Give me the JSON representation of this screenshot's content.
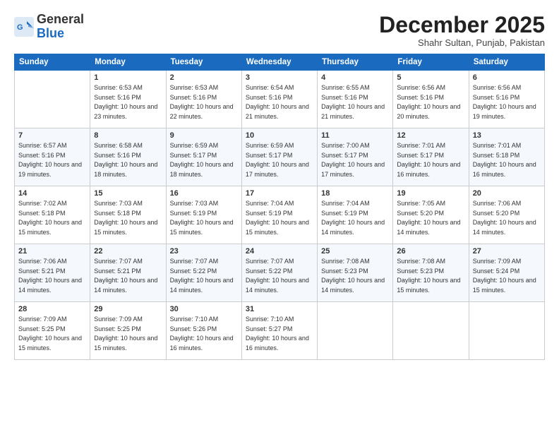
{
  "header": {
    "logo_line1": "General",
    "logo_line2": "Blue",
    "month": "December 2025",
    "location": "Shahr Sultan, Punjab, Pakistan"
  },
  "weekdays": [
    "Sunday",
    "Monday",
    "Tuesday",
    "Wednesday",
    "Thursday",
    "Friday",
    "Saturday"
  ],
  "weeks": [
    [
      {
        "day": "",
        "sunrise": "",
        "sunset": "",
        "daylight": ""
      },
      {
        "day": "1",
        "sunrise": "Sunrise: 6:53 AM",
        "sunset": "Sunset: 5:16 PM",
        "daylight": "Daylight: 10 hours and 23 minutes."
      },
      {
        "day": "2",
        "sunrise": "Sunrise: 6:53 AM",
        "sunset": "Sunset: 5:16 PM",
        "daylight": "Daylight: 10 hours and 22 minutes."
      },
      {
        "day": "3",
        "sunrise": "Sunrise: 6:54 AM",
        "sunset": "Sunset: 5:16 PM",
        "daylight": "Daylight: 10 hours and 21 minutes."
      },
      {
        "day": "4",
        "sunrise": "Sunrise: 6:55 AM",
        "sunset": "Sunset: 5:16 PM",
        "daylight": "Daylight: 10 hours and 21 minutes."
      },
      {
        "day": "5",
        "sunrise": "Sunrise: 6:56 AM",
        "sunset": "Sunset: 5:16 PM",
        "daylight": "Daylight: 10 hours and 20 minutes."
      },
      {
        "day": "6",
        "sunrise": "Sunrise: 6:56 AM",
        "sunset": "Sunset: 5:16 PM",
        "daylight": "Daylight: 10 hours and 19 minutes."
      }
    ],
    [
      {
        "day": "7",
        "sunrise": "Sunrise: 6:57 AM",
        "sunset": "Sunset: 5:16 PM",
        "daylight": "Daylight: 10 hours and 19 minutes."
      },
      {
        "day": "8",
        "sunrise": "Sunrise: 6:58 AM",
        "sunset": "Sunset: 5:16 PM",
        "daylight": "Daylight: 10 hours and 18 minutes."
      },
      {
        "day": "9",
        "sunrise": "Sunrise: 6:59 AM",
        "sunset": "Sunset: 5:17 PM",
        "daylight": "Daylight: 10 hours and 18 minutes."
      },
      {
        "day": "10",
        "sunrise": "Sunrise: 6:59 AM",
        "sunset": "Sunset: 5:17 PM",
        "daylight": "Daylight: 10 hours and 17 minutes."
      },
      {
        "day": "11",
        "sunrise": "Sunrise: 7:00 AM",
        "sunset": "Sunset: 5:17 PM",
        "daylight": "Daylight: 10 hours and 17 minutes."
      },
      {
        "day": "12",
        "sunrise": "Sunrise: 7:01 AM",
        "sunset": "Sunset: 5:17 PM",
        "daylight": "Daylight: 10 hours and 16 minutes."
      },
      {
        "day": "13",
        "sunrise": "Sunrise: 7:01 AM",
        "sunset": "Sunset: 5:18 PM",
        "daylight": "Daylight: 10 hours and 16 minutes."
      }
    ],
    [
      {
        "day": "14",
        "sunrise": "Sunrise: 7:02 AM",
        "sunset": "Sunset: 5:18 PM",
        "daylight": "Daylight: 10 hours and 15 minutes."
      },
      {
        "day": "15",
        "sunrise": "Sunrise: 7:03 AM",
        "sunset": "Sunset: 5:18 PM",
        "daylight": "Daylight: 10 hours and 15 minutes."
      },
      {
        "day": "16",
        "sunrise": "Sunrise: 7:03 AM",
        "sunset": "Sunset: 5:19 PM",
        "daylight": "Daylight: 10 hours and 15 minutes."
      },
      {
        "day": "17",
        "sunrise": "Sunrise: 7:04 AM",
        "sunset": "Sunset: 5:19 PM",
        "daylight": "Daylight: 10 hours and 15 minutes."
      },
      {
        "day": "18",
        "sunrise": "Sunrise: 7:04 AM",
        "sunset": "Sunset: 5:19 PM",
        "daylight": "Daylight: 10 hours and 14 minutes."
      },
      {
        "day": "19",
        "sunrise": "Sunrise: 7:05 AM",
        "sunset": "Sunset: 5:20 PM",
        "daylight": "Daylight: 10 hours and 14 minutes."
      },
      {
        "day": "20",
        "sunrise": "Sunrise: 7:06 AM",
        "sunset": "Sunset: 5:20 PM",
        "daylight": "Daylight: 10 hours and 14 minutes."
      }
    ],
    [
      {
        "day": "21",
        "sunrise": "Sunrise: 7:06 AM",
        "sunset": "Sunset: 5:21 PM",
        "daylight": "Daylight: 10 hours and 14 minutes."
      },
      {
        "day": "22",
        "sunrise": "Sunrise: 7:07 AM",
        "sunset": "Sunset: 5:21 PM",
        "daylight": "Daylight: 10 hours and 14 minutes."
      },
      {
        "day": "23",
        "sunrise": "Sunrise: 7:07 AM",
        "sunset": "Sunset: 5:22 PM",
        "daylight": "Daylight: 10 hours and 14 minutes."
      },
      {
        "day": "24",
        "sunrise": "Sunrise: 7:07 AM",
        "sunset": "Sunset: 5:22 PM",
        "daylight": "Daylight: 10 hours and 14 minutes."
      },
      {
        "day": "25",
        "sunrise": "Sunrise: 7:08 AM",
        "sunset": "Sunset: 5:23 PM",
        "daylight": "Daylight: 10 hours and 14 minutes."
      },
      {
        "day": "26",
        "sunrise": "Sunrise: 7:08 AM",
        "sunset": "Sunset: 5:23 PM",
        "daylight": "Daylight: 10 hours and 15 minutes."
      },
      {
        "day": "27",
        "sunrise": "Sunrise: 7:09 AM",
        "sunset": "Sunset: 5:24 PM",
        "daylight": "Daylight: 10 hours and 15 minutes."
      }
    ],
    [
      {
        "day": "28",
        "sunrise": "Sunrise: 7:09 AM",
        "sunset": "Sunset: 5:25 PM",
        "daylight": "Daylight: 10 hours and 15 minutes."
      },
      {
        "day": "29",
        "sunrise": "Sunrise: 7:09 AM",
        "sunset": "Sunset: 5:25 PM",
        "daylight": "Daylight: 10 hours and 15 minutes."
      },
      {
        "day": "30",
        "sunrise": "Sunrise: 7:10 AM",
        "sunset": "Sunset: 5:26 PM",
        "daylight": "Daylight: 10 hours and 16 minutes."
      },
      {
        "day": "31",
        "sunrise": "Sunrise: 7:10 AM",
        "sunset": "Sunset: 5:27 PM",
        "daylight": "Daylight: 10 hours and 16 minutes."
      },
      {
        "day": "",
        "sunrise": "",
        "sunset": "",
        "daylight": ""
      },
      {
        "day": "",
        "sunrise": "",
        "sunset": "",
        "daylight": ""
      },
      {
        "day": "",
        "sunrise": "",
        "sunset": "",
        "daylight": ""
      }
    ]
  ]
}
